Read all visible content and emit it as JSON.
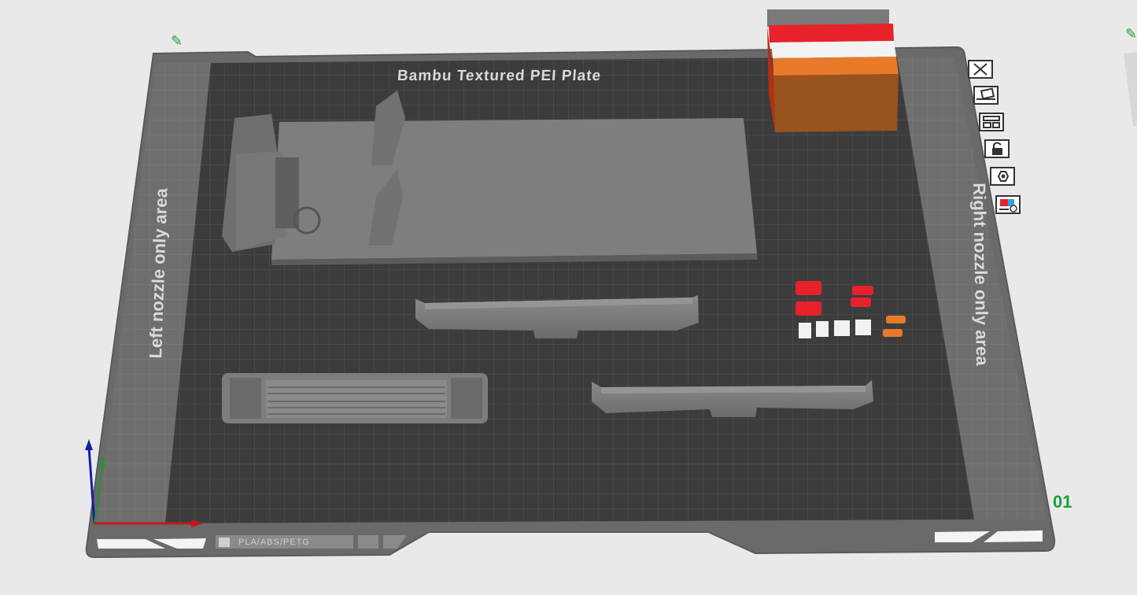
{
  "plate": {
    "title": "Bambu Textured PEI Plate",
    "left_zone_label": "Left nozzle only area",
    "right_zone_label": "Right nozzle only area",
    "plate_number": "01",
    "filament_label": "PLA/ABS/PETG"
  },
  "toolbar": {
    "buttons": [
      {
        "name": "close-plate-button",
        "icon": "close-icon"
      },
      {
        "name": "auto-orient-button",
        "icon": "auto-orient-icon"
      },
      {
        "name": "arrange-button",
        "icon": "arrange-icon"
      },
      {
        "name": "lock-plate-button",
        "icon": "lock-icon"
      },
      {
        "name": "plate-settings-button",
        "icon": "settings-icon"
      },
      {
        "name": "plate-filament-button",
        "icon": "filament-map-icon"
      }
    ]
  },
  "colors": {
    "accent_green": "#19a13b",
    "bed_dark": "#3e3e3e",
    "bed_frame": "#6a6a6a",
    "prime_tower_red": "#e8222a",
    "prime_tower_orange": "#e87a2a",
    "prime_tower_white": "#f2f2f2"
  }
}
